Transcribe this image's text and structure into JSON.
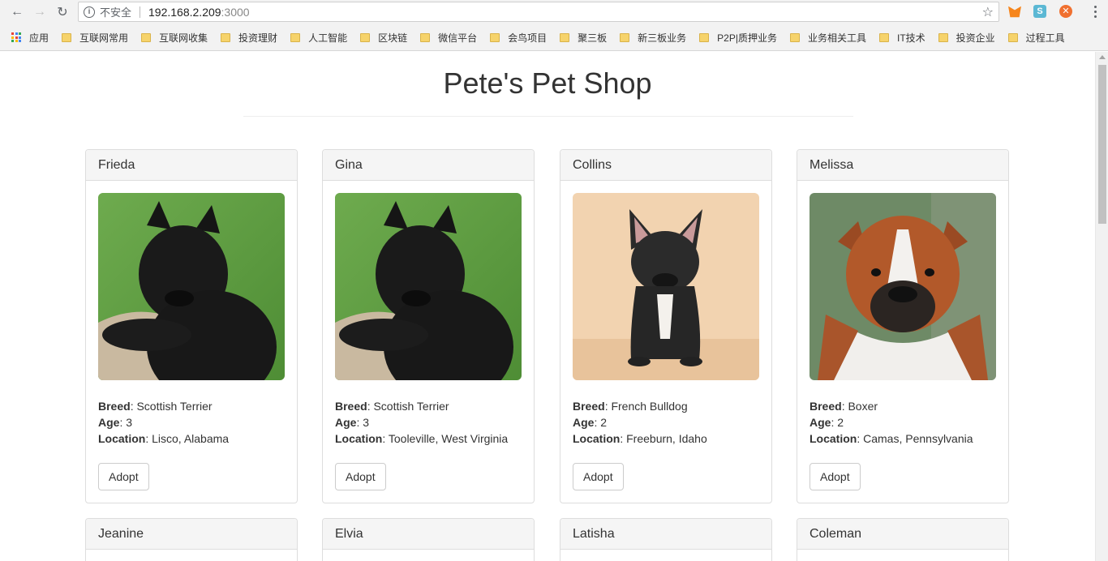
{
  "browser": {
    "insecure_label": "不安全",
    "url_host": "192.168.2.209",
    "url_port": ":3000",
    "bookmarks": [
      {
        "label": "应用"
      },
      {
        "label": "互联网常用"
      },
      {
        "label": "互联网收集"
      },
      {
        "label": "投资理财"
      },
      {
        "label": "人工智能"
      },
      {
        "label": "区块链"
      },
      {
        "label": "微信平台"
      },
      {
        "label": "会鸟项目"
      },
      {
        "label": "聚三板"
      },
      {
        "label": "新三板业务"
      },
      {
        "label": "P2P|质押业务"
      },
      {
        "label": "业务相关工具"
      },
      {
        "label": "IT技术"
      },
      {
        "label": "投资企业"
      },
      {
        "label": "过程工具"
      }
    ]
  },
  "page": {
    "title": "Pete's Pet Shop",
    "labels": {
      "breed": "Breed",
      "age": "Age",
      "location": "Location",
      "adopt": "Adopt"
    },
    "pets": [
      {
        "name": "Frieda",
        "breed": "Scottish Terrier",
        "age": "3",
        "location": "Lisco, Alabama",
        "image": "scottish-terrier"
      },
      {
        "name": "Gina",
        "breed": "Scottish Terrier",
        "age": "3",
        "location": "Tooleville, West Virginia",
        "image": "scottish-terrier"
      },
      {
        "name": "Collins",
        "breed": "French Bulldog",
        "age": "2",
        "location": "Freeburn, Idaho",
        "image": "french-bulldog"
      },
      {
        "name": "Melissa",
        "breed": "Boxer",
        "age": "2",
        "location": "Camas, Pennsylvania",
        "image": "boxer"
      },
      {
        "name": "Jeanine"
      },
      {
        "name": "Elvia"
      },
      {
        "name": "Latisha"
      },
      {
        "name": "Coleman"
      }
    ]
  }
}
